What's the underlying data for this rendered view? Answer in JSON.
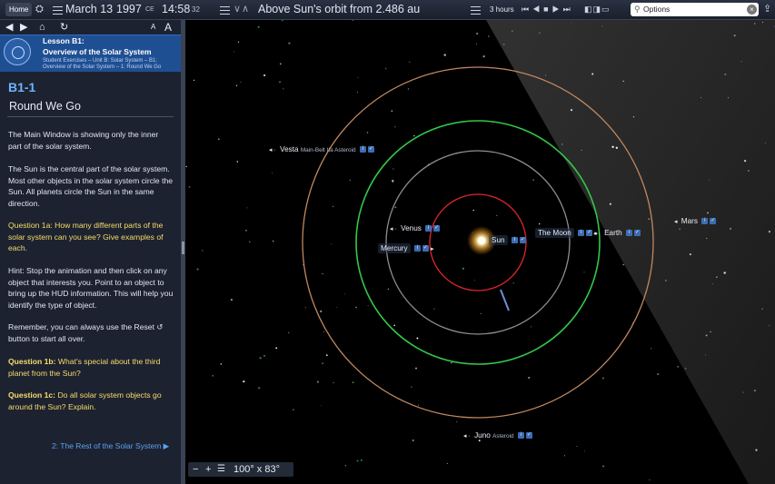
{
  "toolbar": {
    "home_label": "Home",
    "date": "March 13",
    "year": "1997",
    "era": "CE",
    "time": "14:58",
    "seconds": "32",
    "view_title": "Above Sun's orbit from 2.486 au",
    "rate": "3 hours",
    "search_placeholder": "Options",
    "icons": [
      "camera-icon",
      "date-menu-icon",
      "view-menu-icon",
      "chevron-down-icon",
      "chevron-up-icon",
      "rate-menu-icon",
      "skip-back-icon",
      "step-back-icon",
      "stop-icon",
      "step-forward-icon",
      "skip-forward-icon",
      "panel-layout-icon",
      "search-icon",
      "clear-icon",
      "share-icon"
    ]
  },
  "lesson": {
    "nav_icons": [
      "back-arrow-icon",
      "forward-arrow-icon",
      "home-icon",
      "reset-icon"
    ],
    "font_small": "A",
    "font_large": "A",
    "lesson_number": "Lesson B1:",
    "lesson_name": "Overview of the Solar System",
    "breadcrumb_1": "Student Exercises – Unit B: Solar System – B1:",
    "breadcrumb_2": "Overview of the Solar System – 1: Round We Go",
    "section_code": "B1-1",
    "section_title": "Round We Go",
    "p1": "The Main Window is showing only the inner part of the solar system.",
    "p2": "The Sun is the central part of the solar system. Most other objects in the solar system circle the Sun. All planets circle the Sun in the same direction.",
    "q1a": "Question 1a: How many different parts of the solar system can you see? Give examples of each.",
    "hint": "Hint: Stop the animation and then click on any object that interests you. Point to an object to bring up the HUD information. This will help you identify the type of object.",
    "reset_note": "Remember, you can always use the Reset ↺ button to start all over.",
    "q1b_label": "Question 1b:",
    "q1b_text": " What's special about the third planet from the Sun?",
    "q1c_label": "Question 1c:",
    "q1c_text": " Do all solar system objects go around the Sun? Explain.",
    "next_link": "2: The Rest of the Solar System ▶"
  },
  "sky": {
    "objects": {
      "vesta": {
        "name": "Vesta",
        "type": "Main-Belt IIa Asteroid"
      },
      "venus": {
        "name": "Venus"
      },
      "mercury": {
        "name": "Mercury"
      },
      "sun": {
        "name": "Sun"
      },
      "moon": {
        "name": "The Moon"
      },
      "earth": {
        "name": "Earth"
      },
      "mars": {
        "name": "Mars"
      },
      "juno": {
        "name": "Juno",
        "type": "Asteroid"
      }
    },
    "orbit_colors": {
      "mercury": "#e0262b",
      "venus": "#8f8f8f",
      "earth": "#33c648",
      "mars": "#c08860"
    },
    "field_of_view": "100° x 83°"
  }
}
